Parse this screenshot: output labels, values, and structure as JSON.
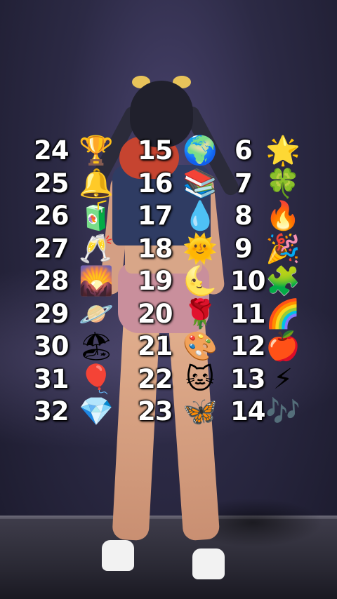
{
  "columns": [
    {
      "items": [
        {
          "number": "24",
          "icon": "trophy-icon",
          "glyph": "🏆"
        },
        {
          "number": "25",
          "icon": "bell-icon",
          "glyph": "🔔"
        },
        {
          "number": "26",
          "icon": "grape-juice-box-icon",
          "glyph": "🧃"
        },
        {
          "number": "27",
          "icon": "champagne-glasses-icon",
          "glyph": "🥂"
        },
        {
          "number": "28",
          "icon": "sunrise-landscape-icon",
          "glyph": "🌄"
        },
        {
          "number": "29",
          "icon": "ringed-planet-icon",
          "glyph": "🪐"
        },
        {
          "number": "30",
          "icon": "beach-umbrella-icon",
          "glyph": "🏖"
        },
        {
          "number": "31",
          "icon": "red-balloon-icon",
          "glyph": "🎈"
        },
        {
          "number": "32",
          "icon": "gem-icon",
          "glyph": "💎"
        }
      ]
    },
    {
      "items": [
        {
          "number": "15",
          "icon": "globe-icon",
          "glyph": "🌍"
        },
        {
          "number": "16",
          "icon": "books-icon",
          "glyph": "📚"
        },
        {
          "number": "17",
          "icon": "droplet-icon",
          "glyph": "💧"
        },
        {
          "number": "18",
          "icon": "sun-with-face-icon",
          "glyph": "🌞"
        },
        {
          "number": "19",
          "icon": "crescent-moon-face-icon",
          "glyph": "🌜"
        },
        {
          "number": "20",
          "icon": "rose-icon",
          "glyph": "🌹"
        },
        {
          "number": "21",
          "icon": "artist-palette-icon",
          "glyph": "🎨"
        },
        {
          "number": "22",
          "icon": "cat-face-icon",
          "glyph": "🐱"
        },
        {
          "number": "23",
          "icon": "butterfly-icon",
          "glyph": "🦋"
        }
      ]
    },
    {
      "items": [
        {
          "number": "6",
          "icon": "star-icon",
          "glyph": "🌟"
        },
        {
          "number": "7",
          "icon": "four-leaf-clover-icon",
          "glyph": "🍀"
        },
        {
          "number": "8",
          "icon": "fire-icon",
          "glyph": "🔥"
        },
        {
          "number": "9",
          "icon": "party-popper-icon",
          "glyph": "🎉"
        },
        {
          "number": "10",
          "icon": "puzzle-piece-icon",
          "glyph": "🧩"
        },
        {
          "number": "11",
          "icon": "rainbow-icon",
          "glyph": "🌈"
        },
        {
          "number": "12",
          "icon": "red-apple-icon",
          "glyph": "🍎"
        },
        {
          "number": "13",
          "icon": "lightning-icon",
          "glyph": "⚡"
        },
        {
          "number": "14",
          "icon": "music-notes-icon",
          "glyph": "🎶"
        }
      ]
    }
  ]
}
